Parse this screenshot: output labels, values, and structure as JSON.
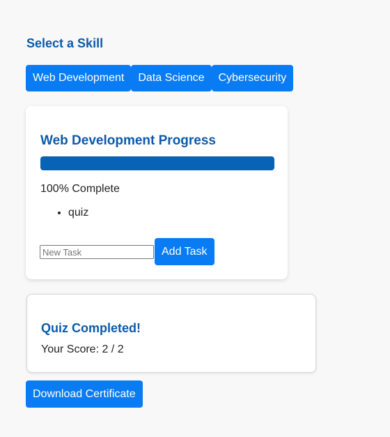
{
  "skills": {
    "heading": "Select a Skill",
    "options": [
      "Web Development",
      "Data Science",
      "Cybersecurity"
    ]
  },
  "progress": {
    "title": "Web Development Progress",
    "percent_complete": 100,
    "status_text": "100% Complete",
    "tasks": [
      "quiz"
    ],
    "new_task_placeholder": "New Task",
    "new_task_value": "",
    "add_task_label": "Add Task"
  },
  "quiz": {
    "title": "Quiz Completed!",
    "score_text": "Your Score: 2 / 2"
  },
  "certificate": {
    "download_label": "Download Certificate"
  },
  "colors": {
    "accent": "#0a7cf3",
    "heading": "#0a5aab",
    "progress_fill": "#0862b5",
    "background": "#f8f8f8"
  }
}
